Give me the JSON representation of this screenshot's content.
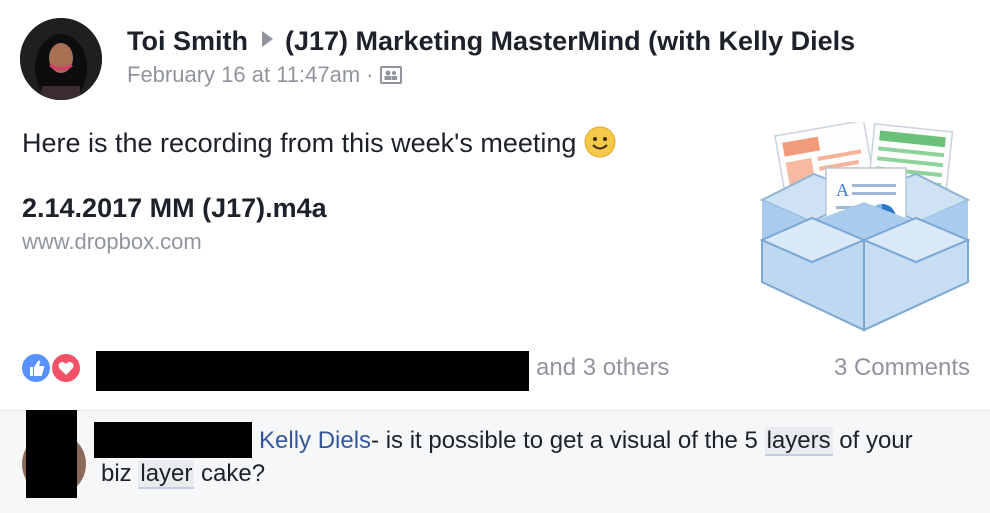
{
  "post": {
    "author": "Toi Smith",
    "group": "(J17) Marketing MasterMind (with Kelly Diels",
    "timestamp": "February 16 at 11:47am",
    "separator": "·",
    "audience_icon": "group-members-icon",
    "text": "Here is the recording from this week's meeting",
    "link": {
      "title": "2.14.2017 MM (J17).m4a",
      "domain": "www.dropbox.com"
    }
  },
  "reactions": {
    "others": "and 3 others",
    "comments_count": "3 Comments"
  },
  "comment": {
    "mention": "Kelly Diels",
    "text_a": "- is it possible to get a visual of the 5 ",
    "highlight_a": "layers",
    "text_b": " of your",
    "text_c": "biz ",
    "highlight_b": "layer",
    "text_d": " cake?"
  },
  "colors": {
    "like": "#5890ff",
    "love": "#f25268",
    "link": "#365899",
    "muted": "#90949c"
  }
}
